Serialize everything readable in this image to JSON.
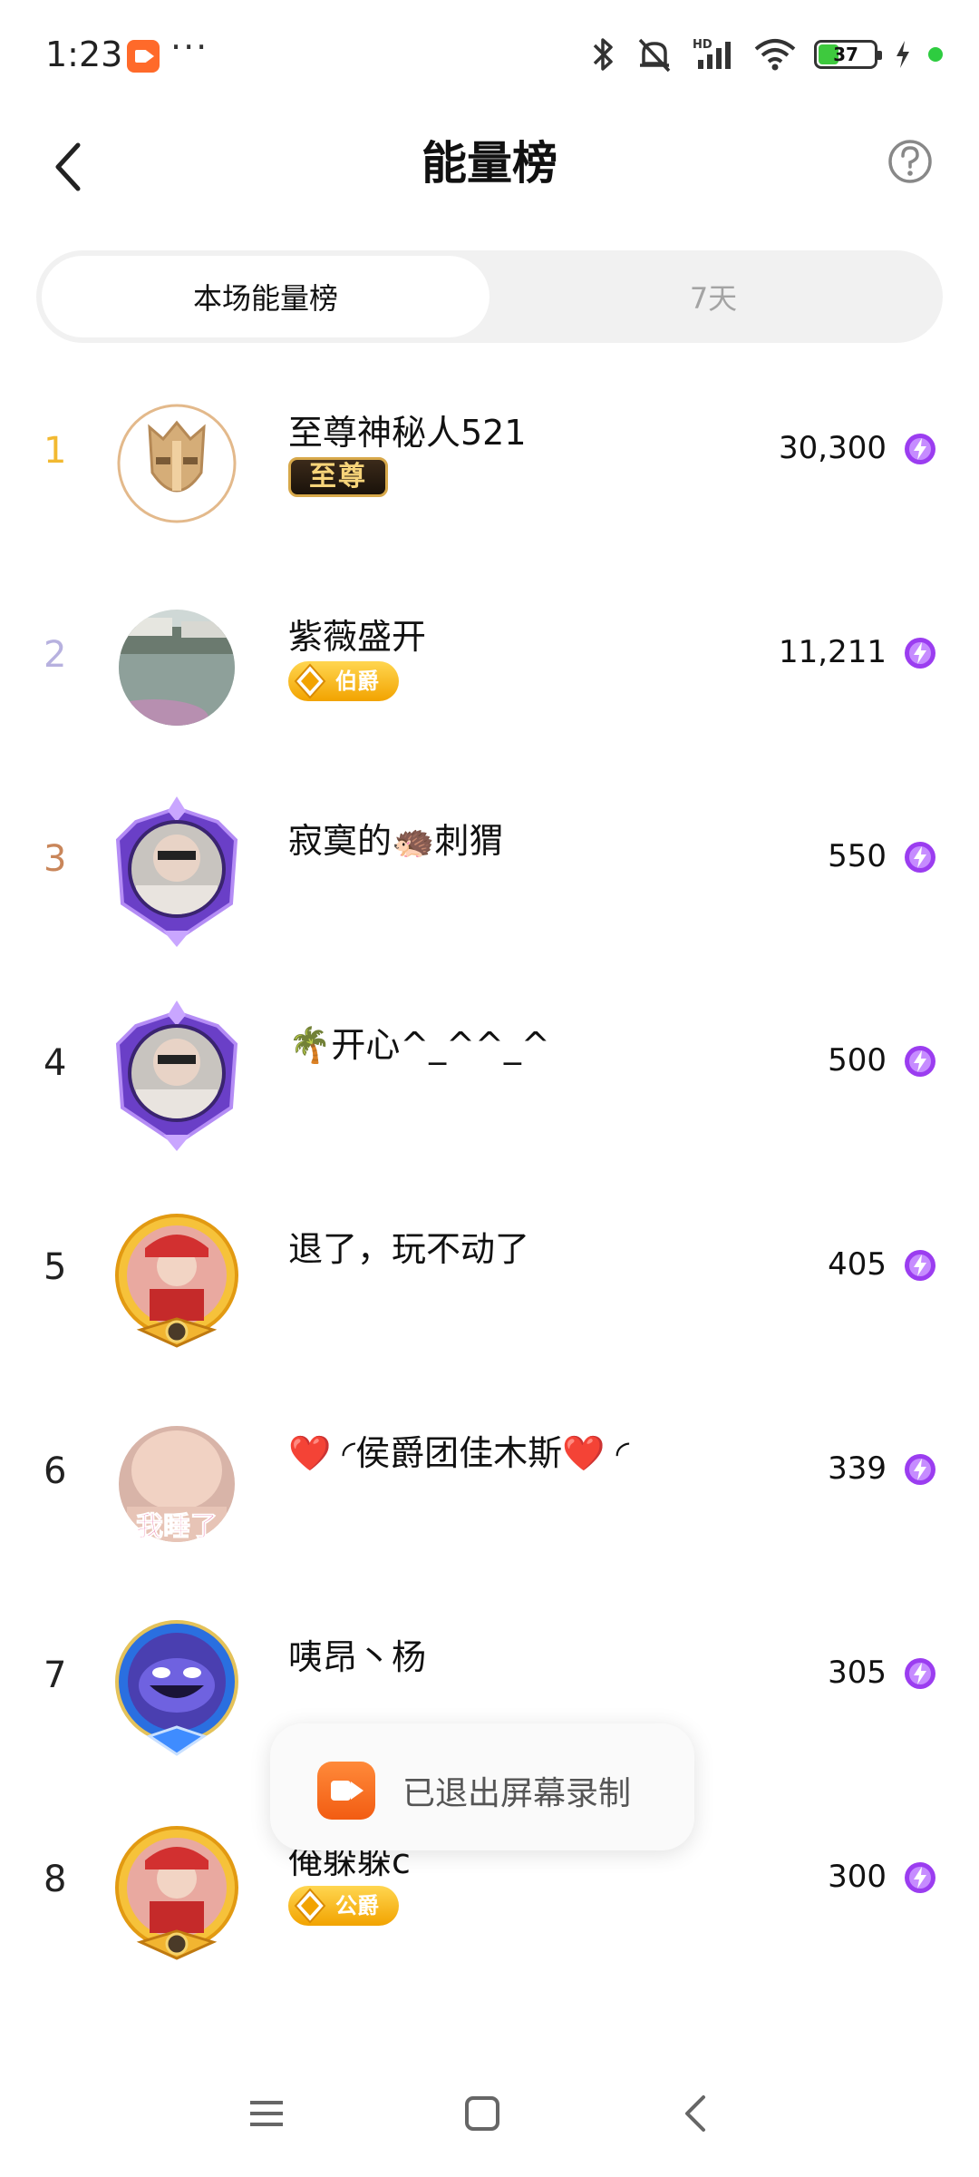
{
  "status_bar": {
    "time": "1:23",
    "more": "···",
    "network_badge": "HD",
    "battery_level": "37",
    "battery_fraction": 0.37
  },
  "header": {
    "title": "能量榜",
    "back_icon": "chevron-left-icon",
    "help_icon": "question-circle-icon"
  },
  "tabs": [
    {
      "label": "本场能量榜",
      "active": true
    },
    {
      "label": "7天",
      "active": false
    }
  ],
  "colors": {
    "rank1": "#f2b931",
    "rank2": "#b7b1df",
    "rank3": "#c9865a",
    "default_rank": "#222222",
    "energy_icon": "#9b3df0"
  },
  "ranking": [
    {
      "rank": "1",
      "name": "至尊神秘人521",
      "badge": "至尊",
      "badge_type": "supreme",
      "score": "30,300",
      "avatar": "gold-mask-avatar"
    },
    {
      "rank": "2",
      "name": "紫薇盛开",
      "badge": "伯爵",
      "badge_type": "gold",
      "score": "11,211",
      "avatar": "lake-photo-avatar"
    },
    {
      "rank": "3",
      "name": "寂寞的🦔刺猬",
      "badge": "",
      "badge_type": "",
      "score": "550",
      "avatar": "purple-frame-avatar"
    },
    {
      "rank": "4",
      "name": "🌴开心^_^^_^",
      "badge": "",
      "badge_type": "",
      "score": "500",
      "avatar": "purple-frame-avatar"
    },
    {
      "rank": "5",
      "name": "退了，玩不动了",
      "badge": "",
      "badge_type": "",
      "score": "405",
      "avatar": "gold-frame-avatar"
    },
    {
      "rank": "6",
      "name": "❤️ ◜侯爵团佳木斯❤️ ◜",
      "badge": "",
      "badge_type": "",
      "score": "339",
      "avatar": "baby-photo-avatar",
      "avatar_text": "我睡了"
    },
    {
      "rank": "7",
      "name": "咦昂丶杨",
      "badge": "",
      "badge_type": "",
      "score": "305",
      "avatar": "blue-frame-avatar"
    },
    {
      "rank": "8",
      "name": "俺躲躲c",
      "badge": "公爵",
      "badge_type": "gold",
      "score": "300",
      "avatar": "gold-frame-avatar"
    }
  ],
  "toast": {
    "text": "已退出屏幕录制"
  },
  "nav": {
    "menu_icon": "menu-icon",
    "home_icon": "home-square-icon",
    "back_icon": "back-triangle-icon"
  }
}
